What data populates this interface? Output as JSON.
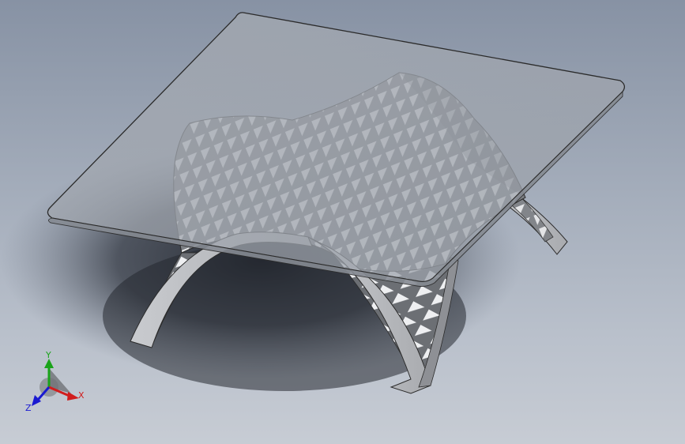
{
  "viewport": {
    "view_type": "isometric 3D model view",
    "background_colors": [
      "#8792a4",
      "#c7ccd4"
    ]
  },
  "model": {
    "description_parts": [
      "glass-tabletop",
      "lattice-shell-base",
      "arch-legs"
    ],
    "glass_color": "#aeb3ba",
    "lattice_color": "#8a8d92",
    "edge_color": "#2b2b2b"
  },
  "triad": {
    "x_label": "X",
    "y_label": "Y",
    "z_label": "Z",
    "x_color": "#d11d1d",
    "y_color": "#1aa31a",
    "z_color": "#1a1ad1"
  }
}
